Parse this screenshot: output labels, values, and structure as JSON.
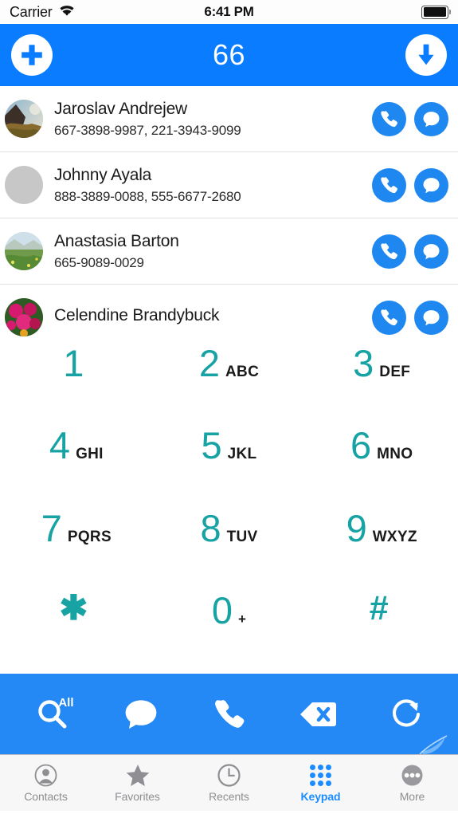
{
  "status_bar": {
    "carrier": "Carrier",
    "time": "6:41 PM",
    "wifi_icon": "wifi-icon",
    "battery_icon": "battery-full-icon"
  },
  "header": {
    "count": "66",
    "add_icon": "plus-circle-icon",
    "download_icon": "download-arrow-circle-icon",
    "background_color": "#0a7cff"
  },
  "contacts": [
    {
      "name": "Jaroslav Andrejew",
      "phones": "667-3898-9987, 221-3943-9099",
      "avatar_type": "photo-landscape-coast",
      "call_icon": "phone-icon",
      "message_icon": "message-bubble-icon"
    },
    {
      "name": "Johnny Ayala",
      "phones": "888-3889-0088, 555-6677-2680",
      "avatar_type": "placeholder-gray",
      "call_icon": "phone-icon",
      "message_icon": "message-bubble-icon"
    },
    {
      "name": "Anastasia Barton",
      "phones": "665-9089-0029",
      "avatar_type": "photo-landscape-field",
      "call_icon": "phone-icon",
      "message_icon": "message-bubble-icon"
    },
    {
      "name": "Celendine Brandybuck",
      "phones": "",
      "avatar_type": "photo-pink-flowers",
      "call_icon": "phone-icon",
      "message_icon": "message-bubble-icon"
    }
  ],
  "keypad": {
    "digit_color": "#17a2a4",
    "rows": [
      [
        {
          "digit": "1",
          "letters": ""
        },
        {
          "digit": "2",
          "letters": "ABC"
        },
        {
          "digit": "3",
          "letters": "DEF"
        }
      ],
      [
        {
          "digit": "4",
          "letters": "GHI"
        },
        {
          "digit": "5",
          "letters": "JKL"
        },
        {
          "digit": "6",
          "letters": "MNO"
        }
      ],
      [
        {
          "digit": "7",
          "letters": "PQRS"
        },
        {
          "digit": "8",
          "letters": "TUV"
        },
        {
          "digit": "9",
          "letters": "WXYZ"
        }
      ],
      [
        {
          "digit": "✱",
          "letters": ""
        },
        {
          "digit": "0",
          "letters": "+"
        },
        {
          "digit": "#",
          "letters": ""
        }
      ]
    ]
  },
  "toolbar": {
    "background_color": "#2488f5",
    "buttons": [
      {
        "icon": "search-icon",
        "badge": "All"
      },
      {
        "icon": "message-bubble-icon",
        "badge": ""
      },
      {
        "icon": "phone-icon",
        "badge": ""
      },
      {
        "icon": "backspace-delete-icon",
        "badge": ""
      },
      {
        "icon": "refresh-redo-icon",
        "badge": ""
      }
    ]
  },
  "tab_bar": {
    "active_color": "#1a8cff",
    "inactive_color": "#8e8e93",
    "tabs": [
      {
        "label": "Contacts",
        "icon": "person-circle-icon",
        "active": false
      },
      {
        "label": "Favorites",
        "icon": "star-icon",
        "active": false
      },
      {
        "label": "Recents",
        "icon": "clock-icon",
        "active": false
      },
      {
        "label": "Keypad",
        "icon": "keypad-dots-icon",
        "active": true
      },
      {
        "label": "More",
        "icon": "ellipsis-circle-icon",
        "active": false
      }
    ]
  }
}
